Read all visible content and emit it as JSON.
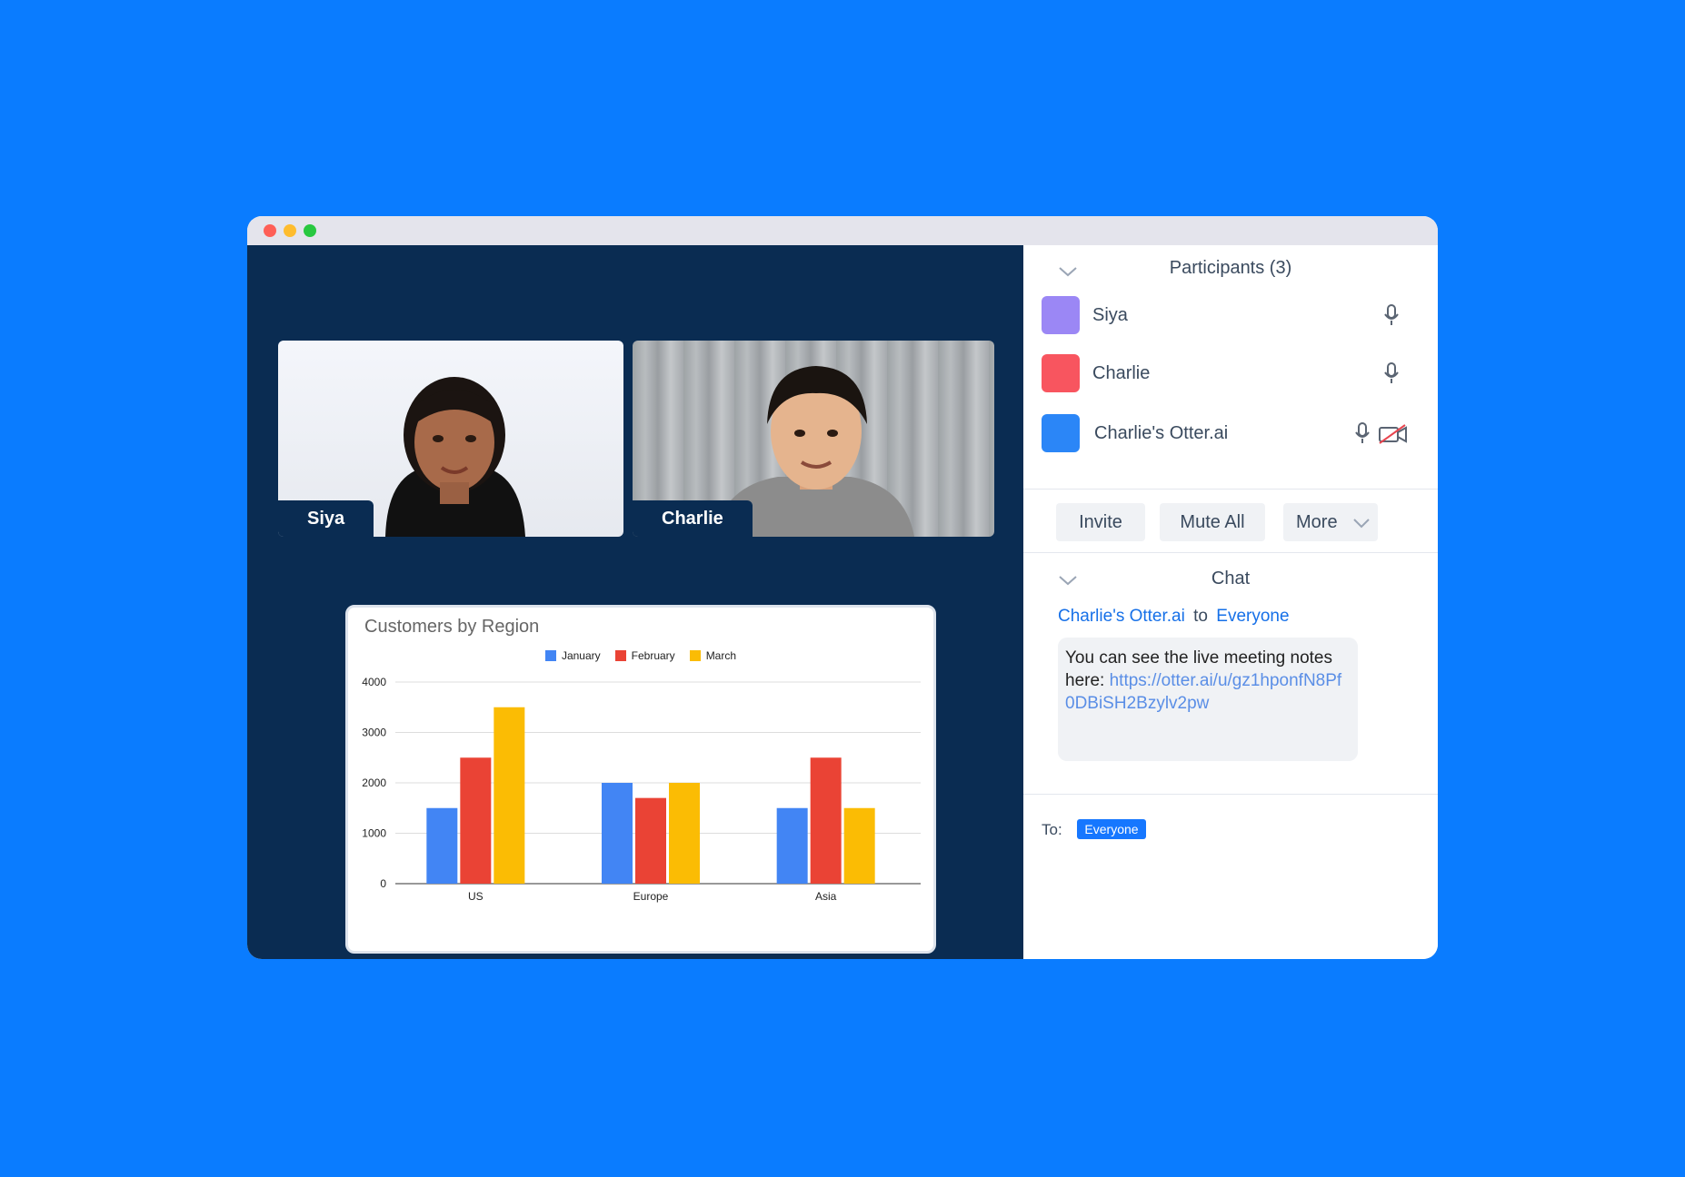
{
  "participants_panel": {
    "title": "Participants (3)",
    "items": [
      {
        "name": "Siya",
        "color": "#9b87f5",
        "mic": "mic-icon"
      },
      {
        "name": "Charlie",
        "color": "#f8555f",
        "mic": "mic-icon"
      },
      {
        "name": "Charlie's Otter.ai",
        "color": "#2b86f7",
        "mic": "mic-icon",
        "video": "video-off-icon"
      }
    ],
    "buttons": {
      "invite": "Invite",
      "mute_all": "Mute All",
      "more": "More"
    }
  },
  "video_tiles": [
    {
      "name": "Siya"
    },
    {
      "name": "Charlie"
    }
  ],
  "chat": {
    "title": "Chat",
    "sender": "Charlie's Otter.ai",
    "to_word": "to",
    "recipient": "Everyone",
    "message_text": "You can see the live meeting notes here: ",
    "message_link": "https://otter.ai/u/gz1hponfN8Pf0DBiSH2Bzylv2pw",
    "to_label": "To:",
    "to_badge": "Everyone"
  },
  "chart_data": {
    "type": "bar",
    "title": "Customers by Region",
    "categories": [
      "US",
      "Europe",
      "Asia"
    ],
    "series": [
      {
        "name": "January",
        "color": "#4285f4",
        "values": [
          1500,
          2000,
          1500
        ]
      },
      {
        "name": "February",
        "color": "#ea4335",
        "values": [
          2500,
          1700,
          2500
        ]
      },
      {
        "name": "March",
        "color": "#fbbc04",
        "values": [
          3500,
          2000,
          1500
        ]
      }
    ],
    "yticks": [
      0,
      1000,
      2000,
      3000,
      4000
    ],
    "ylim": [
      0,
      4000
    ],
    "grid": true,
    "legend": "top-center"
  },
  "colors": {
    "background": "#0a7cff",
    "stage": "#0a2c52",
    "accent": "#1670e8"
  }
}
